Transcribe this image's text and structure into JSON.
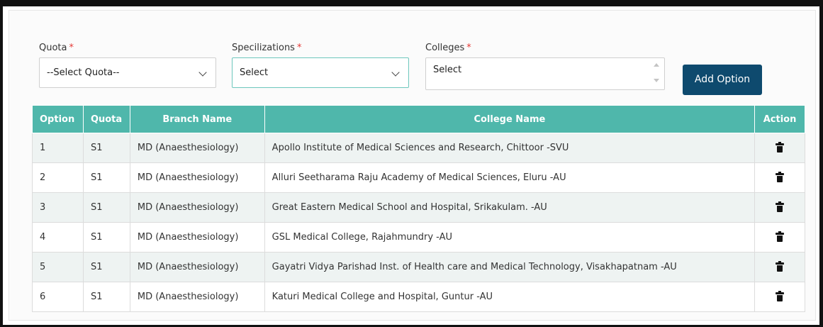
{
  "form": {
    "quota": {
      "label": "Quota",
      "required_mark": "*",
      "value": "--Select Quota--"
    },
    "specializations": {
      "label": "Specilizations",
      "required_mark": "*",
      "value": "Select"
    },
    "colleges": {
      "label": "Colleges",
      "required_mark": "*",
      "value": "Select"
    },
    "add_button": "Add Option"
  },
  "table": {
    "headers": [
      "Option",
      "Quota",
      "Branch Name",
      "College Name",
      "Action"
    ],
    "rows": [
      {
        "option": "1",
        "quota": "S1",
        "branch": "MD (Anaesthesiology)",
        "college": "Apollo Institute of Medical Sciences and Research, Chittoor -SVU"
      },
      {
        "option": "2",
        "quota": "S1",
        "branch": "MD (Anaesthesiology)",
        "college": "Alluri Seetharama Raju Academy of Medical Sciences, Eluru -AU"
      },
      {
        "option": "3",
        "quota": "S1",
        "branch": "MD (Anaesthesiology)",
        "college": "Great Eastern Medical School and Hospital, Srikakulam. -AU"
      },
      {
        "option": "4",
        "quota": "S1",
        "branch": "MD (Anaesthesiology)",
        "college": "GSL Medical College, Rajahmundry -AU"
      },
      {
        "option": "5",
        "quota": "S1",
        "branch": "MD (Anaesthesiology)",
        "college": "Gayatri Vidya Parishad Inst. of Health care and Medical Technology, Visakhapatnam -AU"
      },
      {
        "option": "6",
        "quota": "S1",
        "branch": "MD (Anaesthesiology)",
        "college": "Katuri Medical College and Hospital, Guntur -AU"
      }
    ]
  },
  "icons": {
    "delete": "trash-icon",
    "dropdown": "chevron-down-icon"
  },
  "colors": {
    "header_bg": "#4fb7ab",
    "button_bg": "#0e4a6e",
    "required": "#e53935",
    "row_alt": "#eef3f2"
  }
}
